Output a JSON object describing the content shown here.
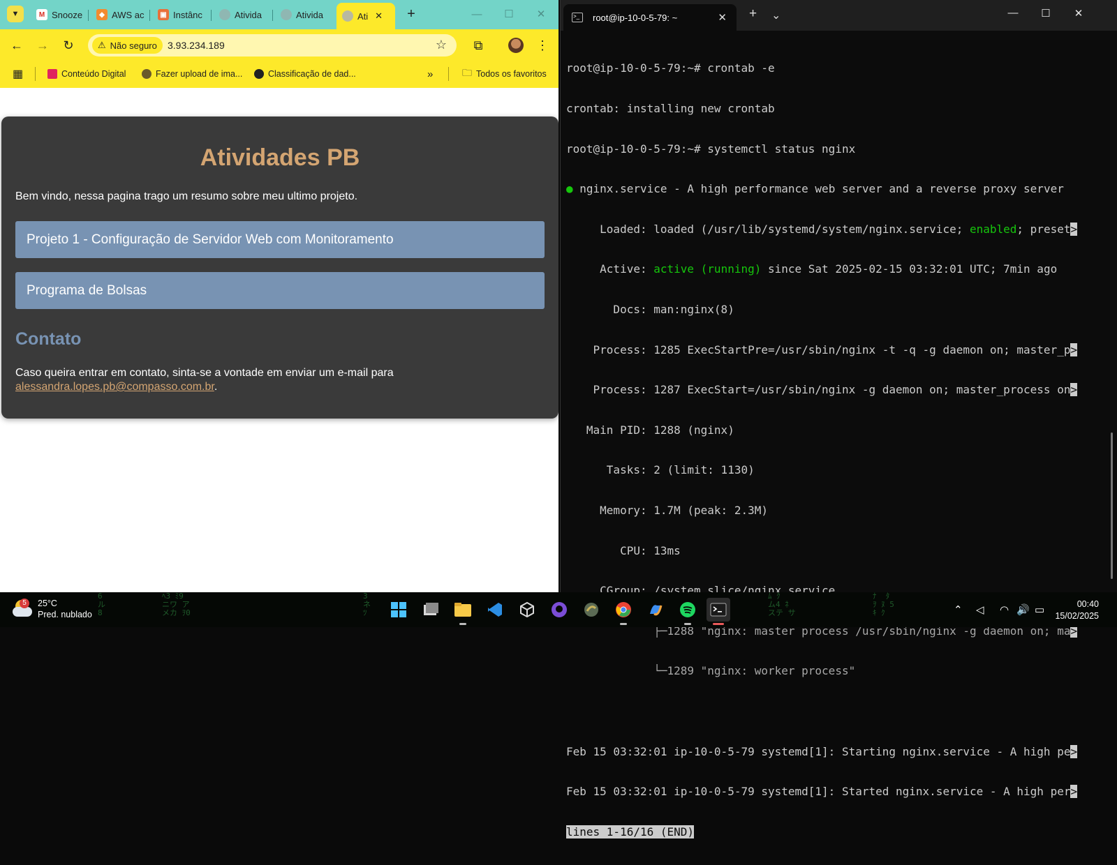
{
  "browser": {
    "tabs": [
      {
        "label": "Snooze",
        "icon": "gmail-icon"
      },
      {
        "label": "AWS ac",
        "icon": "aws-icon"
      },
      {
        "label": "Instânc",
        "icon": "ec2-icon"
      },
      {
        "label": "Ativida",
        "icon": "globe-icon"
      },
      {
        "label": "Ativida",
        "icon": "globe-icon"
      },
      {
        "label": "Ati",
        "icon": "globe-icon"
      }
    ],
    "security_label": "Não seguro",
    "url": "3.93.234.189",
    "bookmarks": [
      {
        "label": "Conteúdo Digital"
      },
      {
        "label": "Fazer upload de ima..."
      },
      {
        "label": "Classificação de dad..."
      }
    ],
    "bookmarks_more": "»",
    "all_bookmarks": "Todos os favoritos"
  },
  "page": {
    "title": "Atividades PB",
    "intro": "Bem vindo, nessa pagina trago um resumo sobre meu ultimo projeto.",
    "projects": [
      "Projeto 1 - Configuração de Servidor Web com Monitoramento",
      "Programa de Bolsas"
    ],
    "contact_heading": "Contato",
    "contact_text": "Caso queira entrar em contato, sinta-se a vontade em enviar um e-mail para",
    "contact_email": "alessandra.lopes.pb@compasso.com.br",
    "contact_end": "."
  },
  "terminal": {
    "tab_title": "root@ip-10-0-5-79: ~",
    "lines": {
      "l1": "root@ip-10-0-5-79:~# crontab -e",
      "l2": "crontab: installing new crontab",
      "l3": "root@ip-10-0-5-79:~# systemctl status nginx",
      "l4_bullet": "●",
      "l4": " nginx.service - A high performance web server and a reverse proxy server",
      "l5a": "     Loaded: loaded (/usr/lib/systemd/system/nginx.service; ",
      "l5b": "enabled",
      "l5c": "; preset",
      "l6a": "     Active: ",
      "l6b": "active (running)",
      "l6c": " since Sat 2025-02-15 03:32:01 UTC; 7min ago",
      "l7": "       Docs: man:nginx(8)",
      "l8": "    Process: 1285 ExecStartPre=/usr/sbin/nginx -t -q -g daemon on; master_p",
      "l9": "    Process: 1287 ExecStart=/usr/sbin/nginx -g daemon on; master_process on",
      "l10": "   Main PID: 1288 (nginx)",
      "l11": "      Tasks: 2 (limit: 1130)",
      "l12": "     Memory: 1.7M (peak: 2.3M)",
      "l13": "        CPU: 13ms",
      "l14": "     CGroup: /system.slice/nginx.service",
      "l15": "             ├─1288 \"nginx: master process /usr/sbin/nginx -g daemon on; ma",
      "l16": "             └─1289 \"nginx: worker process\"",
      "l17": "",
      "l18": "Feb 15 03:32:01 ip-10-0-5-79 systemd[1]: Starting nginx.service - A high pe",
      "l19": "Feb 15 03:32:01 ip-10-0-5-79 systemd[1]: Started nginx.service - A high per",
      "l20": "lines 1-16/16 (END)"
    }
  },
  "taskbar": {
    "weather_temp": "25°C",
    "weather_desc": "Pred. nublado",
    "weather_badge": "5",
    "time": "00:40",
    "date": "15/02/2025"
  },
  "colors": {
    "tabstrip": "#73d4c8",
    "toolbar": "#fde92a",
    "card": "#3a3a3a",
    "title": "#d4a572",
    "project_bar": "#7893b3",
    "terminal_green": "#16c60c"
  }
}
